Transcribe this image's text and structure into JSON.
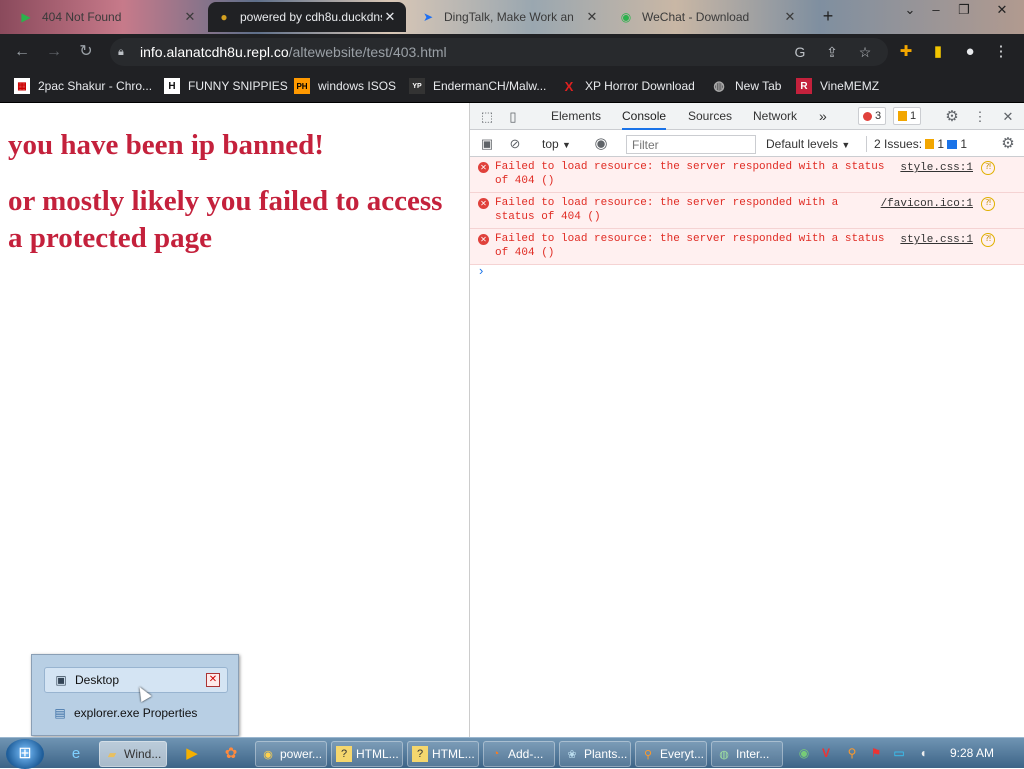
{
  "browser": {
    "tabs": [
      {
        "title": "404 Not Found",
        "icon": "play-icon",
        "active": false
      },
      {
        "title": "powered by cdh8u.duckdns",
        "icon": "globe-icon",
        "active": true
      },
      {
        "title": "DingTalk, Make Work an",
        "icon": "dingtalk-icon",
        "active": false
      },
      {
        "title": "WeChat - Download",
        "icon": "wechat-icon",
        "active": false
      }
    ],
    "new_tab": "+",
    "omnibox": {
      "host": "info.alanatcdh8u.repl.co",
      "path": "/altewebsite/test/403.html"
    },
    "bookmarks": [
      {
        "label": "2pac Shakur - Chro...",
        "icon": "calendar-icon"
      },
      {
        "label": "FUNNY SNIPPIES",
        "icon": "h-icon",
        "glyph": "H"
      },
      {
        "label": "windows ISOS",
        "icon": "ph-icon",
        "glyph": "PH"
      },
      {
        "label": "EndermanCH/Malw...",
        "icon": "yp-icon",
        "glyph": "YP"
      },
      {
        "label": "XP Horror Download",
        "icon": "x-icon",
        "glyph": "X"
      },
      {
        "label": "New Tab",
        "icon": "globe-icon"
      },
      {
        "label": "VineMEMZ",
        "icon": "r-icon",
        "glyph": "R"
      }
    ]
  },
  "page": {
    "heading": "you have been ip banned!",
    "subheading": "or mostly likely you failed to access a protected page"
  },
  "devtools": {
    "tabs": [
      "Elements",
      "Console",
      "Sources",
      "Network"
    ],
    "selected_tab": "Console",
    "more": "»",
    "error_count": "3",
    "warning_count": "1",
    "context": "top",
    "filter_placeholder": "Filter",
    "levels": "Default levels",
    "issues_label": "2 Issues:",
    "issues_warn": "1",
    "issues_info": "1",
    "messages": [
      {
        "text": "Failed to load resource: the server responded with a status of 404 ()",
        "source": "style.css:1"
      },
      {
        "text": "Failed to load resource: the server responded with a status of 404 ()",
        "source": "/favicon.ico:1"
      },
      {
        "text": "Failed to load resource: the server responded with a status of 404 ()",
        "source": "style.css:1"
      }
    ],
    "prompt": "›"
  },
  "jumplist": {
    "items": [
      {
        "label": "Desktop",
        "icon": "desktop-icon"
      },
      {
        "label": "explorer.exe Properties",
        "icon": "properties-icon"
      }
    ]
  },
  "taskbar": {
    "buttons": [
      {
        "label": "Wind...",
        "icon": "folder-icon",
        "selected": true
      },
      {
        "label": "",
        "icon": "media-icon",
        "selected": false
      },
      {
        "label": "",
        "icon": "paint-icon",
        "selected": false
      },
      {
        "label": "power...",
        "icon": "chrome-icon",
        "selected": false
      },
      {
        "label": "HTML...",
        "icon": "help-icon",
        "selected": false
      },
      {
        "label": "HTML...",
        "icon": "help-icon",
        "selected": false
      },
      {
        "label": "Add-...",
        "icon": "firefox-icon",
        "selected": false
      },
      {
        "label": "Plants...",
        "icon": "game-icon",
        "selected": false
      },
      {
        "label": "Everyt...",
        "icon": "search-icon",
        "selected": false
      },
      {
        "label": "Inter...",
        "icon": "ie-icon",
        "selected": false
      }
    ],
    "clock": "9:28 AM"
  }
}
